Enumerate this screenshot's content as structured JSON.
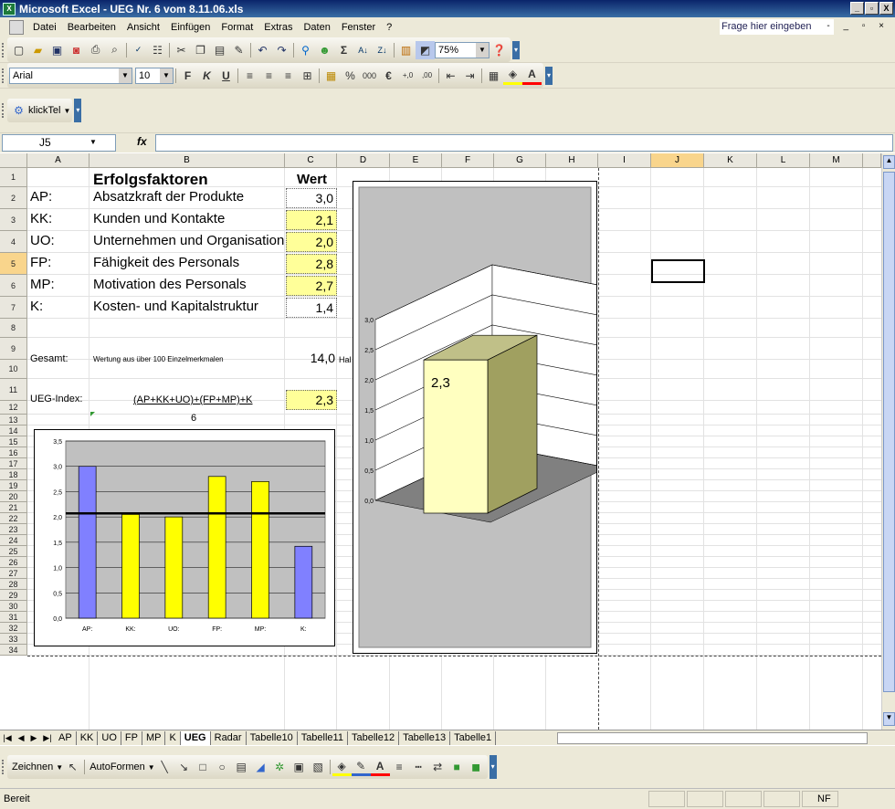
{
  "window": {
    "title": "Microsoft Excel - UEG Nr. 6 vom 8.11.06.xls",
    "min_glyph": "_",
    "max_glyph": "▫",
    "close_glyph": "X"
  },
  "menu": {
    "items": [
      "Datei",
      "Bearbeiten",
      "Ansicht",
      "Einfügen",
      "Format",
      "Extras",
      "Daten",
      "Fenster",
      "?"
    ],
    "ask_placeholder": "Frage hier eingeben",
    "doc_controls": "- _ ▫ ×"
  },
  "toolbar": {
    "zoom": "75%",
    "font_name": "Arial",
    "font_size": "10",
    "bold": "F",
    "italic": "K",
    "underline": "U",
    "percent": "%",
    "thousands": "000",
    "euro": "€",
    "addin_label": "klickTel",
    "icons": [
      "new-icon",
      "open-icon",
      "save-icon",
      "permission-icon",
      "print-icon",
      "print-preview-icon",
      "spelling-icon",
      "research-icon",
      "cut-icon",
      "copy-icon",
      "paste-icon",
      "format-painter-icon",
      "undo-icon",
      "redo-icon",
      "hyperlink-icon",
      "chart-wizard-icon",
      "sum-icon",
      "sort-asc-icon",
      "sort-desc-icon",
      "chart-icon",
      "drawing-icon",
      "help-icon"
    ]
  },
  "formula_bar": {
    "cell_ref": "J5",
    "fx": "fx",
    "value": ""
  },
  "columns": [
    "A",
    "B",
    "C",
    "D",
    "E",
    "F",
    "G",
    "H",
    "I",
    "J",
    "K",
    "L",
    "M"
  ],
  "rows": [
    "1",
    "2",
    "3",
    "4",
    "5",
    "6",
    "7",
    "8",
    "9",
    "10",
    "11",
    "12",
    "13",
    "14",
    "15",
    "16",
    "17",
    "18",
    "19",
    "20",
    "21",
    "22",
    "23",
    "24",
    "25",
    "26",
    "27",
    "28",
    "29",
    "30",
    "31",
    "32",
    "33",
    "34"
  ],
  "sheet": {
    "header_title": "Erfolgsfaktoren",
    "header_value": "Wert",
    "factors": [
      {
        "code": "AP:",
        "name": "Absatzkraft der Produkte",
        "value": "3,0"
      },
      {
        "code": "KK:",
        "name": "Kunden und Kontakte",
        "value": "2,1"
      },
      {
        "code": "UO:",
        "name": "Unternehmen und Organisation",
        "value": "2,0"
      },
      {
        "code": "FP:",
        "name": "Fähigkeit des Personals",
        "value": "2,8"
      },
      {
        "code": "MP:",
        "name": "Motivation des Personals",
        "value": "2,7"
      },
      {
        "code": "K:",
        "name": "Kosten- und Kapitalstruktur",
        "value": "1,4"
      }
    ],
    "gesamt_label": "Gesamt:",
    "gesamt_desc": "Wertung aus über 100 Einzelmerkmalen",
    "gesamt_value": "14,0",
    "gesamt_suffix": "Hal",
    "ueg_label": "UEG-Index:",
    "ueg_formula": "(AP+KK+UO)+(FP+MP)+K",
    "ueg_value": "2,3",
    "ueg_divisor": "6"
  },
  "chart_data": [
    {
      "type": "bar",
      "categories": [
        "AP:",
        "KK:",
        "UO:",
        "FP:",
        "MP:",
        "K:"
      ],
      "values": [
        3.0,
        2.05,
        2.0,
        2.8,
        2.7,
        1.42
      ],
      "reference_line": 2.07,
      "ylim": [
        0,
        3.5
      ],
      "yticks": [
        "0,0",
        "0,5",
        "1,0",
        "1,5",
        "2,0",
        "2,5",
        "3,0",
        "3,5"
      ],
      "colors": [
        "#8080ff",
        "#ffff00",
        "#ffff00",
        "#ffff00",
        "#ffff00",
        "#8080ff"
      ],
      "grid": true
    },
    {
      "type": "bar",
      "categories": [
        ""
      ],
      "values": [
        2.3
      ],
      "data_label": "2,3",
      "ylim": [
        0,
        3.0
      ],
      "yticks": [
        "0,0",
        "0,5",
        "1,0",
        "1,5",
        "2,0",
        "2,5",
        "3,0"
      ],
      "colors": [
        "#ffffc0"
      ],
      "grid": true
    }
  ],
  "sheet_tabs": [
    "AP",
    "KK",
    "UO",
    "FP",
    "MP",
    "K",
    "UEG",
    "Radar",
    "Tabelle10",
    "Tabelle11",
    "Tabelle12",
    "Tabelle13",
    "Tabelle1"
  ],
  "active_tab": "UEG",
  "draw_toolbar": {
    "zeichnen": "Zeichnen",
    "autoformen": "AutoFormen"
  },
  "status": {
    "text": "Bereit",
    "nf": "NF"
  }
}
